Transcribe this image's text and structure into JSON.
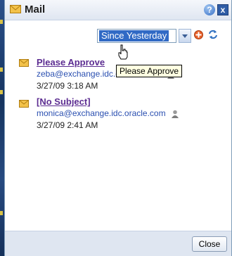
{
  "window": {
    "title": "Mail",
    "help_label": "?",
    "close_label": "x"
  },
  "toolbar": {
    "filter_selected": "Since Yesterday",
    "add_icon": "add-icon",
    "refresh_icon": "refresh-icon"
  },
  "messages": [
    {
      "subject": "Please Approve",
      "sender": "zeba@exchange.idc.oracle.com",
      "date": "3/27/09 3:18 AM"
    },
    {
      "subject": "[No Subject]",
      "sender": "monica@exchange.idc.oracle.com",
      "date": "3/27/09 2:41 AM"
    }
  ],
  "tooltip": {
    "text": "Please Approve"
  },
  "footer": {
    "close_label": "Close"
  },
  "colors": {
    "accent": "#2f5da6",
    "subject": "#5c2d91",
    "link": "#2a4fb0"
  }
}
